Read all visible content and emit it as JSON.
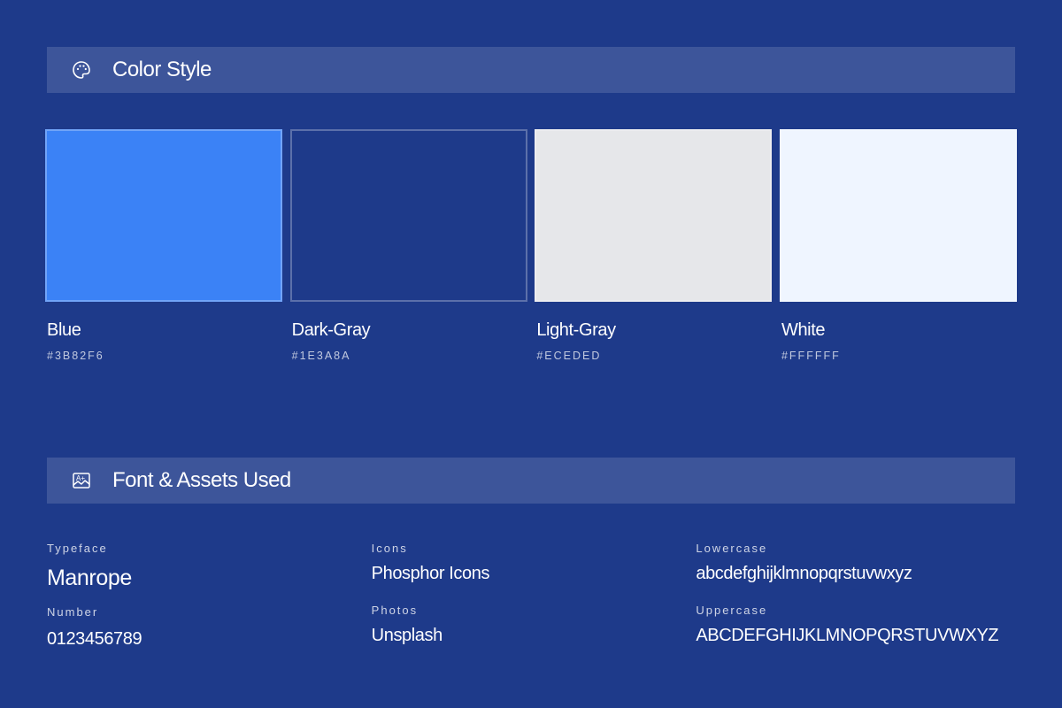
{
  "color_section": {
    "title": "Color Style",
    "icon": "palette-icon",
    "swatches": [
      {
        "name": "Blue",
        "hex_label": "#3B82F6",
        "color": "#3B82F6"
      },
      {
        "name": "Dark-Gray",
        "hex_label": "#1E3A8A",
        "color": "#1E3A8A"
      },
      {
        "name": "Light-Gray",
        "hex_label": "#ECEDED",
        "color": "#E6E7EA"
      },
      {
        "name": "White",
        "hex_label": "#FFFFFF",
        "color": "#EFF5FF"
      }
    ]
  },
  "font_section": {
    "title": "Font & Assets Used",
    "icon": "text-image-icon",
    "typeface_label": "Typeface",
    "typeface_value": "Manrope",
    "number_label": "Number",
    "number_value": "0123456789",
    "icons_label": "Icons",
    "icons_value": "Phosphor Icons",
    "photos_label": "Photos",
    "photos_value": "Unsplash",
    "lowercase_label": "Lowercase",
    "lowercase_value": "abcdefghijklmnopqrstuvwxyz",
    "uppercase_label": "Uppercase",
    "uppercase_value": "ABCDEFGHIJKLMNOPQRSTUVWXYZ"
  },
  "colors": {
    "background": "#1E3A8A",
    "bar": "#3A5398"
  }
}
